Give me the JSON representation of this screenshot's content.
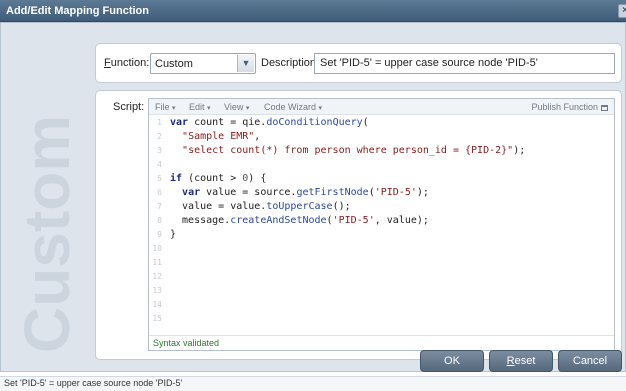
{
  "window": {
    "title": "Add/Edit Mapping Function",
    "close_glyph": "×"
  },
  "watermark_text": "Custom",
  "function_label": {
    "hotkey": "F",
    "rest": "unction:"
  },
  "function_select": {
    "value": "Custom",
    "arrow_glyph": "▼"
  },
  "description_label": "Description:",
  "description_value": "Set 'PID-5' = upper case source node 'PID-5'",
  "script_label": "Script:",
  "editor_menu": {
    "file": "File",
    "edit": "Edit",
    "view": "View",
    "code_wizard": "Code Wizard",
    "caret": "▾",
    "publish": "Publish Function"
  },
  "line_numbers": [
    "1",
    "2",
    "3",
    "4",
    "5",
    "6",
    "7",
    "8",
    "9",
    "10",
    "11",
    "12",
    "13",
    "14",
    "15"
  ],
  "code_lines": [
    "var count = qie.doConditionQuery(",
    "  \"Sample EMR\",",
    "  \"select count(*) from person where person_id = {PID-2}\");",
    "",
    "if (count > 0) {",
    "  var value = source.getFirstNode('PID-5');",
    "  value = value.toUpperCase();",
    "  message.createAndSetNode('PID-5', value);",
    "}",
    "",
    "",
    "",
    "",
    "",
    ""
  ],
  "syntax_status": "Syntax validated",
  "buttons": {
    "ok": "OK",
    "reset_hotkey": "R",
    "reset_rest": "eset",
    "cancel": "Cancel"
  },
  "status_bar": "Set 'PID-5' = upper case source node 'PID-5'",
  "colors": {
    "titlebar": "#4a6782",
    "dialog_bg": "#dde4ec",
    "button": "#66788c",
    "syntax_ok": "#2f7a2f"
  }
}
